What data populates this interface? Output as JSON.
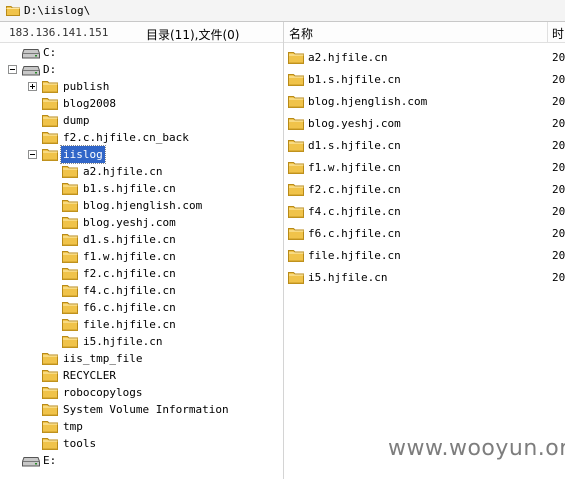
{
  "path_bar": {
    "path": "D:\\iislog\\"
  },
  "left_panel": {
    "host_ip": "183.136.141.151",
    "counts": "目录(11),文件(0)",
    "tree": [
      {
        "label": "C:",
        "type": "drive",
        "level": 0,
        "expander": ""
      },
      {
        "label": "D:",
        "type": "drive",
        "level": 0,
        "expander": "minus"
      },
      {
        "label": "publish",
        "type": "folder",
        "level": 1,
        "expander": "plus"
      },
      {
        "label": "blog2008",
        "type": "folder",
        "level": 1,
        "expander": ""
      },
      {
        "label": "dump",
        "type": "folder",
        "level": 1,
        "expander": ""
      },
      {
        "label": "f2.c.hjfile.cn_back",
        "type": "folder",
        "level": 1,
        "expander": ""
      },
      {
        "label": "iislog",
        "type": "folder",
        "level": 1,
        "expander": "minus",
        "selected": true
      },
      {
        "label": "a2.hjfile.cn",
        "type": "folder",
        "level": 2,
        "expander": ""
      },
      {
        "label": "b1.s.hjfile.cn",
        "type": "folder",
        "level": 2,
        "expander": ""
      },
      {
        "label": "blog.hjenglish.com",
        "type": "folder",
        "level": 2,
        "expander": ""
      },
      {
        "label": "blog.yeshj.com",
        "type": "folder",
        "level": 2,
        "expander": ""
      },
      {
        "label": "d1.s.hjfile.cn",
        "type": "folder",
        "level": 2,
        "expander": ""
      },
      {
        "label": "f1.w.hjfile.cn",
        "type": "folder",
        "level": 2,
        "expander": ""
      },
      {
        "label": "f2.c.hjfile.cn",
        "type": "folder",
        "level": 2,
        "expander": ""
      },
      {
        "label": "f4.c.hjfile.cn",
        "type": "folder",
        "level": 2,
        "expander": ""
      },
      {
        "label": "f6.c.hjfile.cn",
        "type": "folder",
        "level": 2,
        "expander": ""
      },
      {
        "label": "file.hjfile.cn",
        "type": "folder",
        "level": 2,
        "expander": ""
      },
      {
        "label": "i5.hjfile.cn",
        "type": "folder",
        "level": 2,
        "expander": ""
      },
      {
        "label": "iis_tmp_file",
        "type": "folder",
        "level": 1,
        "expander": ""
      },
      {
        "label": "RECYCLER",
        "type": "folder",
        "level": 1,
        "expander": ""
      },
      {
        "label": "robocopylogs",
        "type": "folder",
        "level": 1,
        "expander": ""
      },
      {
        "label": "System Volume Information",
        "type": "folder",
        "level": 1,
        "expander": ""
      },
      {
        "label": "tmp",
        "type": "folder",
        "level": 1,
        "expander": ""
      },
      {
        "label": "tools",
        "type": "folder",
        "level": 1,
        "expander": ""
      },
      {
        "label": "E:",
        "type": "drive",
        "level": 0,
        "expander": ""
      }
    ]
  },
  "right_panel": {
    "columns": {
      "name": "名称",
      "time": "时"
    },
    "files": [
      {
        "name": "a2.hjfile.cn",
        "date": "20"
      },
      {
        "name": "b1.s.hjfile.cn",
        "date": "20"
      },
      {
        "name": "blog.hjenglish.com",
        "date": "20"
      },
      {
        "name": "blog.yeshj.com",
        "date": "20"
      },
      {
        "name": "d1.s.hjfile.cn",
        "date": "20"
      },
      {
        "name": "f1.w.hjfile.cn",
        "date": "20"
      },
      {
        "name": "f2.c.hjfile.cn",
        "date": "20"
      },
      {
        "name": "f4.c.hjfile.cn",
        "date": "20"
      },
      {
        "name": "f6.c.hjfile.cn",
        "date": "20"
      },
      {
        "name": "file.hjfile.cn",
        "date": "20"
      },
      {
        "name": "i5.hjfile.cn",
        "date": "20"
      }
    ]
  },
  "watermark": {
    "text": "www.wooyun.org"
  },
  "colors": {
    "folder": "#f0c34a",
    "folder_dark": "#c99a22",
    "selection": "#3166c8"
  }
}
